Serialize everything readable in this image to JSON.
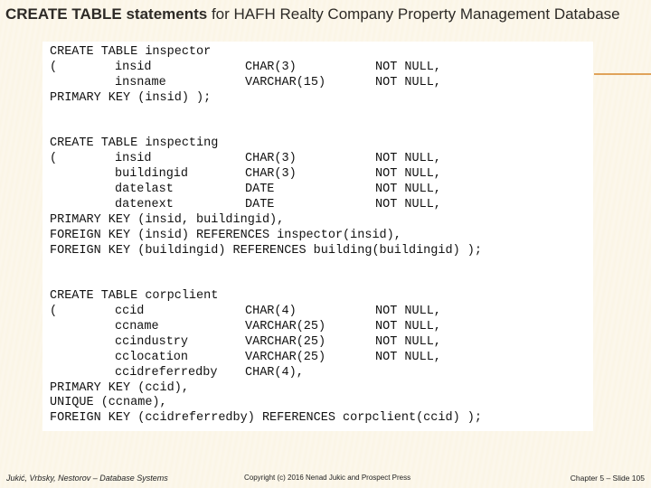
{
  "slide": {
    "title_bold": "CREATE TABLE statements",
    "title_rest": " for HAFH Realty Company Property Management Database",
    "colors": {
      "background": "#fbf5e6",
      "accent_line": "#e0a35a",
      "code_box": "#ffffff"
    }
  },
  "code": {
    "blocks": [
      {
        "lines": [
          [
            "CREATE TABLE inspector",
            "",
            "",
            ""
          ],
          [
            "(",
            "insid",
            "CHAR(3)",
            "NOT NULL,"
          ],
          [
            "",
            "insname",
            "VARCHAR(15)",
            "NOT NULL,"
          ],
          [
            "PRIMARY KEY (insid) );",
            "",
            "",
            ""
          ]
        ]
      },
      {
        "lines": [
          [
            "CREATE TABLE inspecting",
            "",
            "",
            ""
          ],
          [
            "(",
            "insid",
            "CHAR(3)",
            "NOT NULL,"
          ],
          [
            "",
            "buildingid",
            "CHAR(3)",
            "NOT NULL,"
          ],
          [
            "",
            "datelast",
            "DATE",
            "NOT NULL,"
          ],
          [
            "",
            "datenext",
            "DATE",
            "NOT NULL,"
          ],
          [
            "PRIMARY KEY (insid, buildingid),",
            "",
            "",
            ""
          ],
          [
            "FOREIGN KEY (insid) REFERENCES inspector(insid),",
            "",
            "",
            ""
          ],
          [
            "FOREIGN KEY (buildingid) REFERENCES building(buildingid) );",
            "",
            "",
            ""
          ]
        ]
      },
      {
        "lines": [
          [
            "CREATE TABLE corpclient",
            "",
            "",
            ""
          ],
          [
            "(",
            "ccid",
            "CHAR(4)",
            "NOT NULL,"
          ],
          [
            "",
            "ccname",
            "VARCHAR(25)",
            "NOT NULL,"
          ],
          [
            "",
            "ccindustry",
            "VARCHAR(25)",
            "NOT NULL,"
          ],
          [
            "",
            "cclocation",
            "VARCHAR(25)",
            "NOT NULL,"
          ],
          [
            "",
            "ccidreferredby",
            "CHAR(4),",
            ""
          ],
          [
            "PRIMARY KEY (ccid),",
            "",
            "",
            ""
          ],
          [
            "UNIQUE (ccname),",
            "",
            "",
            ""
          ],
          [
            "FOREIGN KEY (ccidreferredby) REFERENCES corpclient(ccid) );",
            "",
            "",
            ""
          ]
        ]
      }
    ]
  },
  "footer": {
    "authors": "Jukić, Vrbsky, Nestorov – Database Systems",
    "copyright": "Copyright (c) 2016 Nenad Jukic and Prospect Press",
    "slide_ref": "Chapter 5 – Slide 105"
  }
}
